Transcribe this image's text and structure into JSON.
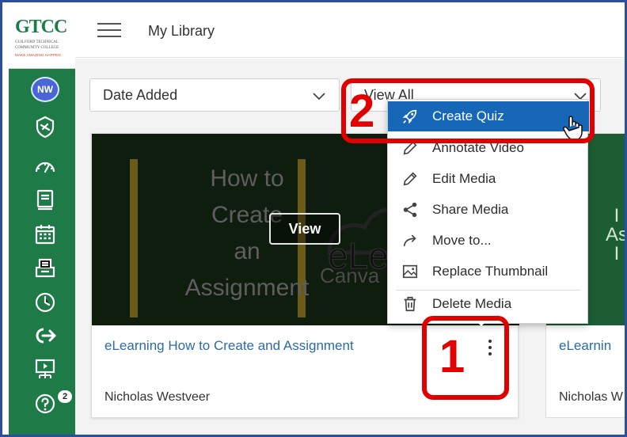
{
  "header": {
    "title": "My Library"
  },
  "logo": {
    "name": "GTCC",
    "line1": "GUILFORD TECHNICAL",
    "line2": "COMMUNITY COLLEGE",
    "tagline": "MAKE AMAZING HAPPEN"
  },
  "nav": {
    "avatar_initials": "NW",
    "items": [
      "admin-icon",
      "dashboard-icon",
      "courses-icon",
      "calendar-icon",
      "inbox-icon",
      "history-icon",
      "logout-icon",
      "studio-icon",
      "help-icon"
    ],
    "help_badge": "2"
  },
  "filters": {
    "sort_value": "Date Added",
    "view_value": "View All"
  },
  "card": {
    "thumbnail_text": [
      "How to",
      "Create",
      "an",
      "Assignment"
    ],
    "thumbnail_brand": "eLe",
    "thumbnail_sub": "Canva",
    "view_label": "View",
    "title": "eLearning How to Create and Assignment",
    "author": "Nicholas Westveer"
  },
  "card2": {
    "thumbnail_text": [
      "I",
      "As",
      "I"
    ],
    "title": "eLearnin",
    "author": "Nicholas W"
  },
  "menu": {
    "items": [
      {
        "label": "Create Quiz",
        "icon": "rocket-icon"
      },
      {
        "label": "Annotate Video",
        "icon": "pencil-icon"
      },
      {
        "label": "Edit Media",
        "icon": "edit-icon"
      },
      {
        "label": "Share Media",
        "icon": "share-icon"
      },
      {
        "label": "Move to...",
        "icon": "arrow-icon"
      },
      {
        "label": "Replace Thumbnail",
        "icon": "image-icon"
      },
      {
        "label": "Delete Media",
        "icon": "trash-icon"
      }
    ]
  },
  "annotations": {
    "step1": "1",
    "step2": "2"
  },
  "colors": {
    "nav_green": "#1e7a46",
    "link_blue": "#2b6aa7",
    "menu_active": "#1767b8",
    "annotation_red": "#e00000"
  }
}
